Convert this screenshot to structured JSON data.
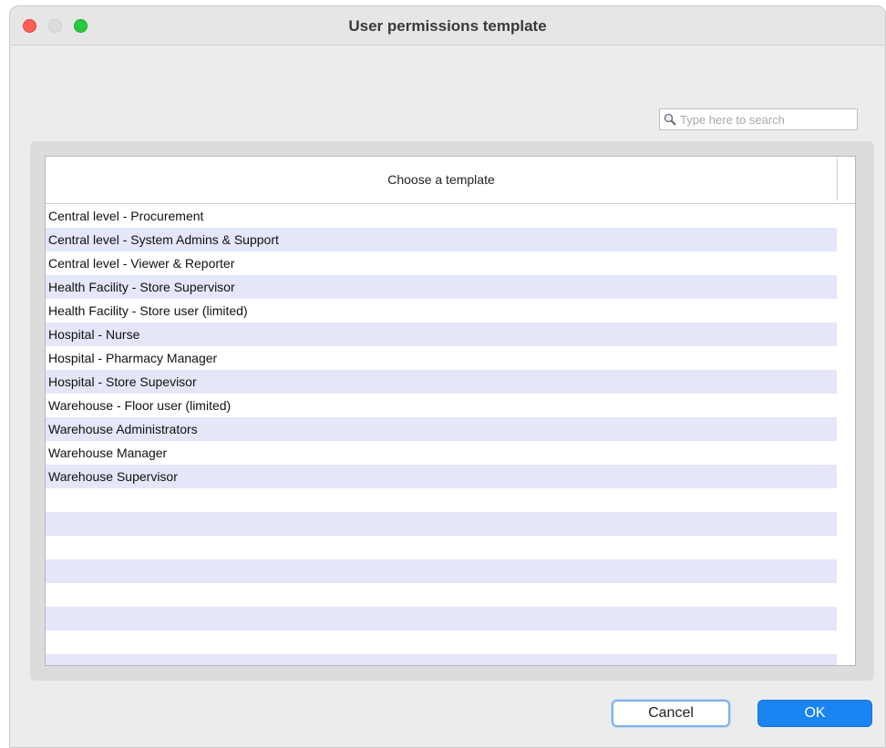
{
  "window": {
    "title": "User permissions template"
  },
  "search": {
    "placeholder": "Type here to search"
  },
  "table": {
    "column_header": "Choose a template",
    "rows": [
      "Central level - Procurement",
      "Central level - System Admins & Support",
      "Central level - Viewer & Reporter",
      "Health Facility - Store Supervisor",
      "Health Facility - Store user (limited)",
      "Hospital - Nurse",
      "Hospital - Pharmacy Manager",
      "Hospital - Store Supevisor",
      "Warehouse - Floor user (limited)",
      "Warehouse Administrators",
      "Warehouse Manager",
      "Warehouse Supervisor"
    ],
    "empty_rows": 8
  },
  "buttons": {
    "cancel_label": "Cancel",
    "ok_label": "OK"
  },
  "colors": {
    "row_alt": "#e4e6fa",
    "ok_button": "#1a84f2",
    "close": "#fe5f57",
    "zoom": "#28c840"
  },
  "icons": {
    "search": "magnifier-icon"
  }
}
